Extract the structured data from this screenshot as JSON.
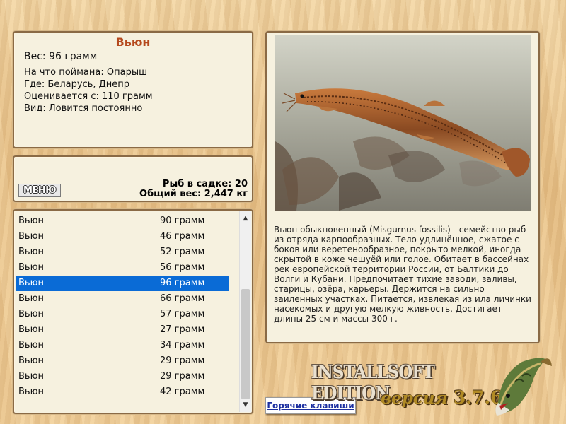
{
  "fish_info": {
    "name": "Вьюн",
    "weight_line": "Вес: 96 грамм",
    "bait_line": "На что поймана: Опарыш",
    "location_line": "Где: Беларусь, Днепр",
    "valued_from_line": "Оценивается с: 110 грамм",
    "type_line": "Вид: Ловится постоянно"
  },
  "stats": {
    "menu_label": "МЕНЮ",
    "fish_count_line": "Рыб в садке: 20",
    "total_weight_line": "Общий вес: 2,447 кг"
  },
  "catch_list": [
    {
      "name": "Вьюн",
      "weight": "90 грамм"
    },
    {
      "name": "Вьюн",
      "weight": "46 грамм"
    },
    {
      "name": "Вьюн",
      "weight": "52 грамм"
    },
    {
      "name": "Вьюн",
      "weight": "56 грамм"
    },
    {
      "name": "Вьюн",
      "weight": "96 грамм",
      "selected": true
    },
    {
      "name": "Вьюн",
      "weight": "66 грамм"
    },
    {
      "name": "Вьюн",
      "weight": "57 грамм"
    },
    {
      "name": "Вьюн",
      "weight": "27 грамм"
    },
    {
      "name": "Вьюн",
      "weight": "34 грамм"
    },
    {
      "name": "Вьюн",
      "weight": "29 грамм"
    },
    {
      "name": "Вьюн",
      "weight": "29 грамм"
    },
    {
      "name": "Вьюн",
      "weight": "42 грамм"
    }
  ],
  "description": "Вьюн обыкновенный (Misgurnus fossilis) - семейство рыб из отряда карпообразных. Тело удлинённое, сжатое с боков или веретенообразное, покрыто мелкой, иногда скрытой в коже чешуёй или голое. Обитает в бассейнах рек европейской территории России, от Балтики до Волги и Кубани. Предпочитает тихие заводи, заливы, старицы, озёра, карьеры. Держится на сильно заиленных участках. Питается, извлекая из ила личинки насекомых и другую мелкую живность. Достигает длины 25 см и массы 300 г.",
  "hotkeys_label": "Горячие клавиши",
  "branding": {
    "edition": "INSTALLSOFT EDITION",
    "version_word": "версия",
    "version_number": "3.7.6"
  },
  "icons": {
    "scroll_up": "chevron-up-icon",
    "scroll_down": "chevron-down-icon",
    "logo": "pike-fish-icon"
  },
  "colors": {
    "title": "#b5491d",
    "selection": "#0a6bd6",
    "panel_bg": "#f6f1df",
    "link": "#1c2fa0"
  }
}
